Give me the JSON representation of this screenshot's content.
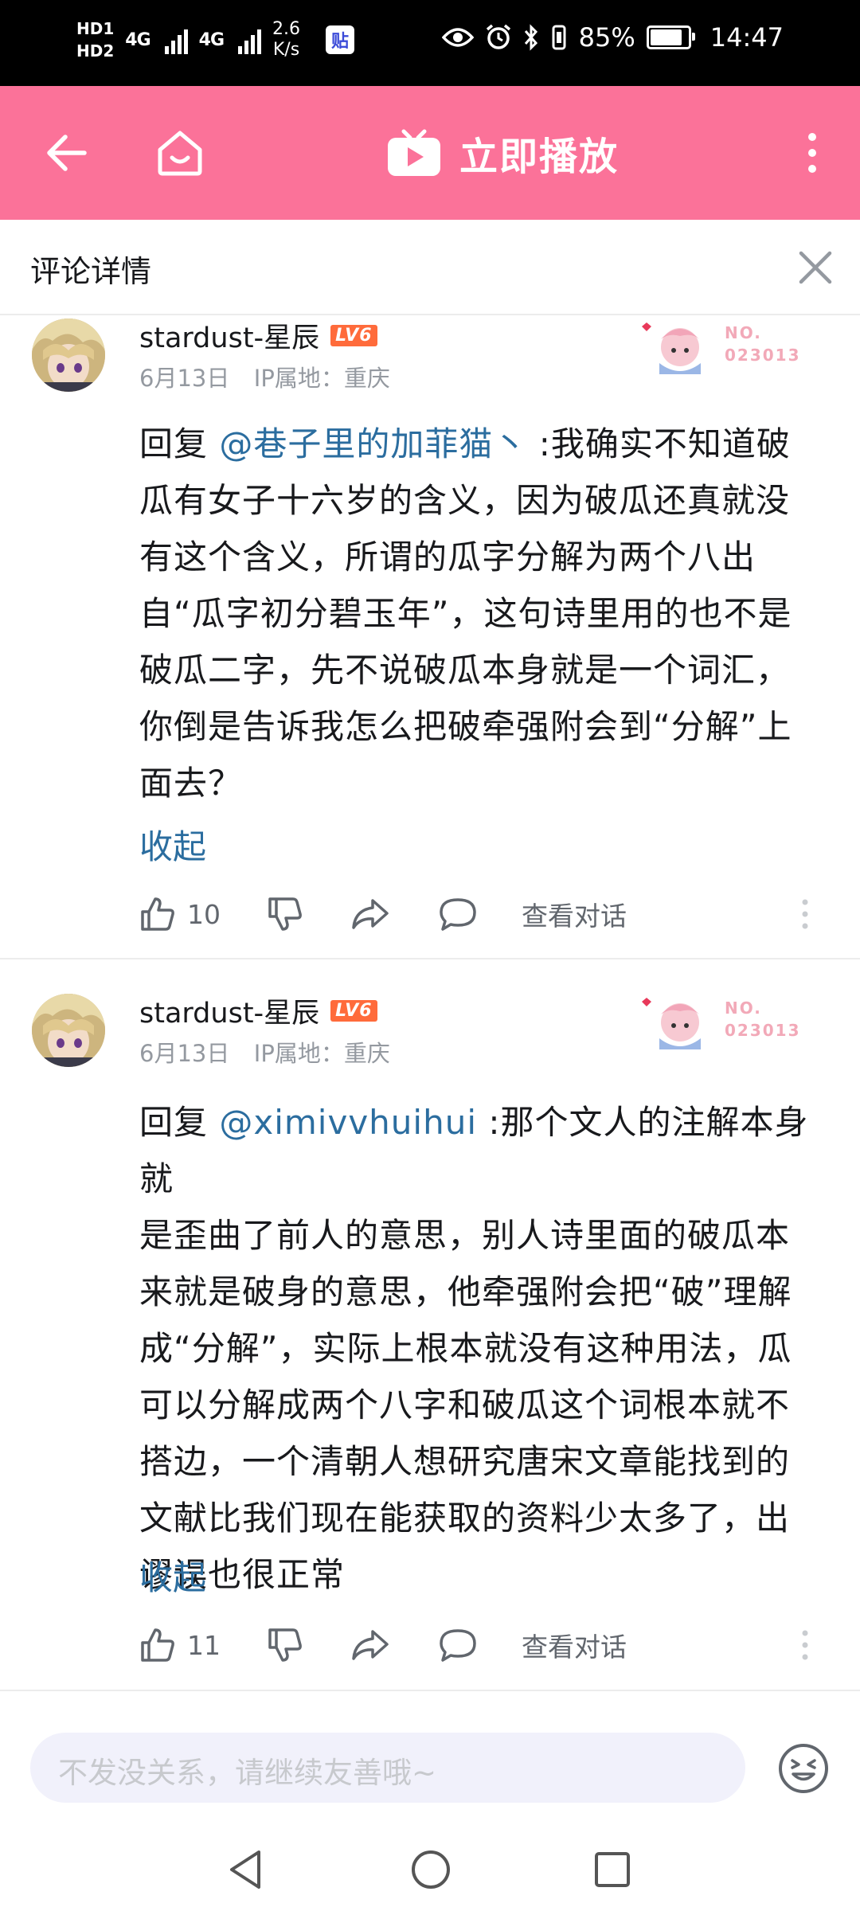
{
  "status_bar": {
    "hd_top": "HD1",
    "hd_bottom": "HD2",
    "net1": "4G",
    "net2": "4G",
    "speed_value": "2.6",
    "speed_unit": "K/s",
    "tieba_icon": "贴",
    "battery": "85%",
    "battery_level": 0.85,
    "time": "14:47"
  },
  "top_bar": {
    "play_label": "立即播放",
    "color": "#fb7299"
  },
  "detail_header": {
    "title": "评论详情"
  },
  "comments": [
    {
      "username": "stardust-星辰",
      "level": "LV6",
      "date": "6月13日",
      "ip": "IP属地：重庆",
      "badge_label": "NO.",
      "badge_number": "023013",
      "reply_prefix": "回复 ",
      "mention": "@巷子里的加菲猫丶",
      "lines": [
        " :我确实不知道破",
        "瓜有女子十六岁的含义，因为破瓜还真就没",
        "有这个含义，所谓的瓜字分解为两个八出",
        "自“瓜字初分碧玉年”，这句诗里用的也不是",
        "破瓜二字，先不说破瓜本身就是一个词汇，",
        "你倒是告诉我怎么把破牵强附会到“分解”上",
        "面去？"
      ],
      "collapse": "收起",
      "likes": "10",
      "view_dialog": "查看对话"
    },
    {
      "username": "stardust-星辰",
      "level": "LV6",
      "date": "6月13日",
      "ip": "IP属地：重庆",
      "badge_label": "NO.",
      "badge_number": "023013",
      "reply_prefix": "回复 ",
      "mention": "@ximivvhuihui",
      "lines": [
        " :那个文人的注解本身就",
        "是歪曲了前人的意思，别人诗里面的破瓜本",
        "来就是破身的意思，他牵强附会把“破”理解",
        "成“分解”，实际上根本就没有这种用法，瓜",
        "可以分解成两个八字和破瓜这个词根本就不",
        "搭边，一个清朝人想研究唐宋文章能找到的",
        "文献比我们现在能获取的资料少太多了，出",
        "谬误也很正常"
      ],
      "collapse": "收起",
      "likes": "11",
      "view_dialog": "查看对话"
    }
  ],
  "input": {
    "placeholder": "不发没关系，请继续友善哦~"
  },
  "icons": {
    "back": "back-arrow-icon",
    "home": "home-icon",
    "tv": "tv-play-icon",
    "more": "more-vertical-icon",
    "close": "close-icon",
    "like": "thumbs-up-icon",
    "dislike": "thumbs-down-icon",
    "share": "share-icon",
    "reply": "comment-icon",
    "emoji": "emoji-icon"
  }
}
